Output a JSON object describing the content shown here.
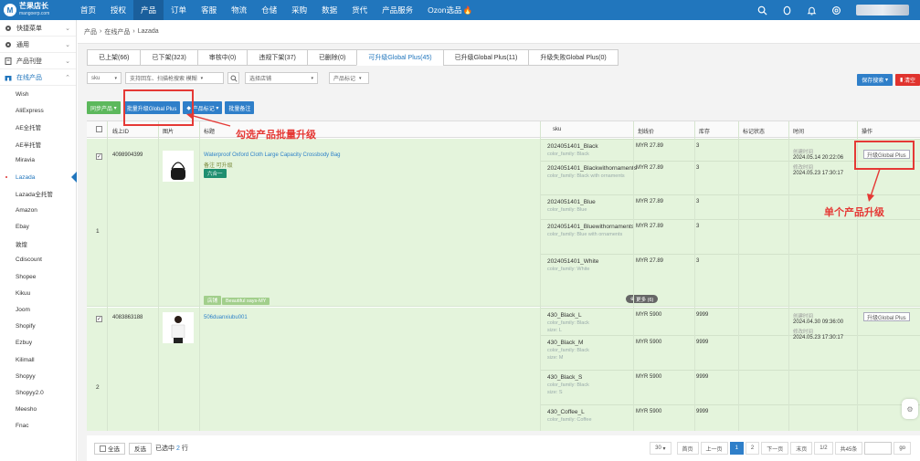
{
  "brand": {
    "name": "芒果店长",
    "sub": "mangoerp.com"
  },
  "nav": [
    "首页",
    "授权",
    "产品",
    "订单",
    "客服",
    "物流",
    "仓储",
    "采购",
    "数据",
    "货代",
    "产品服务",
    "Ozon选品"
  ],
  "nav_active": 2,
  "sidebar": {
    "groups": [
      "快捷菜单",
      "通用",
      "产品刊登",
      "在线产品"
    ],
    "items": [
      "Wish",
      "AliExpress",
      "AE全托管",
      "AE半托管",
      "Miravia",
      "Lazada",
      "Lazada全托管",
      "Amazon",
      "Ebay",
      "敦煌",
      "Cdiscount",
      "Shopee",
      "Kikuu",
      "Joom",
      "Shopify",
      "Ezbuy",
      "Kilimall",
      "Shopyy",
      "Shopyy2.0",
      "Meesho",
      "Fnac"
    ],
    "active_item": 5
  },
  "breadcrumb": [
    "产品",
    "›",
    "在线产品",
    "›",
    "Lazada"
  ],
  "tabs": [
    "已上架(66)",
    "已下架(323)",
    "审核中(0)",
    "违规下架(37)",
    "已删除(0)",
    "可升级Global Plus(45)",
    "已升级Global Plus(11)",
    "升级失败Global Plus(0)"
  ],
  "tab_active": 5,
  "filters": {
    "field": "sku",
    "search_placeholder": "支持回车、扫描枪搜索 模糊",
    "store": "选择店铺",
    "mark": "产品标记"
  },
  "right_buttons": {
    "save_search": "保存搜索",
    "clear": "清空"
  },
  "actions": {
    "sync": "同步产品",
    "batch_upgrade": "批量升级Global Plus",
    "mark": "产品标记",
    "batch_note": "批量备注"
  },
  "annotations": {
    "batch": "勾选产品批量升级",
    "single": "单个产品升级"
  },
  "headers": [
    "线上ID",
    "图片",
    "标题",
    "sku",
    "划线价",
    "库存",
    "标记状态",
    "时间",
    "操作"
  ],
  "products": [
    {
      "index": "1",
      "id": "4098904399",
      "title": "Waterproof Oxford Cloth Large Capacity Crossbody Bag",
      "note": "备注 可升级",
      "badge": "六合一",
      "store": "店铺",
      "store_name": "Beautiful says-MY",
      "created_label": "创建时间",
      "created": "2024.05.14 20:22:06",
      "modified_label": "修改时间",
      "modified": "2024.05.23 17:30:17",
      "upgrade": "升级Global Plus",
      "more": "更多 (6)",
      "skus": [
        {
          "sku": "2024051401_Black",
          "attr": "color_family: Black",
          "price": "MYR 27.89",
          "stock": "3"
        },
        {
          "sku": "2024051401_Blackwithornaments",
          "attr": "color_family: Black with ornaments",
          "price": "MYR 27.89",
          "stock": "3"
        },
        {
          "sku": "2024051401_Blue",
          "attr": "color_family: Blue",
          "price": "MYR 27.89",
          "stock": "3"
        },
        {
          "sku": "2024051401_Bluewithornaments",
          "attr": "color_family: Blue with ornaments",
          "price": "MYR 27.89",
          "stock": "3"
        },
        {
          "sku": "2024051401_White",
          "attr": "color_family: White",
          "price": "MYR 27.89",
          "stock": "3"
        }
      ]
    },
    {
      "index": "2",
      "id": "4083863188",
      "title": "506duanxiubu001",
      "created_label": "创建时间",
      "created": "2024.04.30 09:36:00",
      "modified_label": "修改时间",
      "modified": "2024.05.23 17:30:17",
      "upgrade": "升级Global Plus",
      "skus": [
        {
          "sku": "430_Black_L",
          "attr": "color_family: Black",
          "attr2": "size: L",
          "price": "MYR 5900",
          "stock": "9999"
        },
        {
          "sku": "430_Black_M",
          "attr": "color_family: Black",
          "attr2": "size: M",
          "price": "MYR 5900",
          "stock": "9999"
        },
        {
          "sku": "430_Black_S",
          "attr": "color_family: Black",
          "attr2": "size: S",
          "price": "MYR 5900",
          "stock": "9999"
        },
        {
          "sku": "430_Coffee_L",
          "attr": "color_family: Coffee",
          "price": "MYR 5900",
          "stock": "9999"
        }
      ]
    }
  ],
  "footer": {
    "select_all": "全选",
    "invert": "反选",
    "selected_prefix": "已选中",
    "selected_count": "2",
    "selected_suffix": "行",
    "page_size": "30",
    "first": "首页",
    "prev": "上一页",
    "pages": [
      "1",
      "2"
    ],
    "next": "下一页",
    "last": "末页",
    "page_info": "1/2",
    "total": "共45条",
    "go": "go"
  },
  "colors": {
    "topbar": "#2176bd",
    "row_selected": "#e4f4dc",
    "annotation": "#e53935",
    "primary_btn": "#2f7fc9",
    "sync_btn": "#5cb85c"
  }
}
